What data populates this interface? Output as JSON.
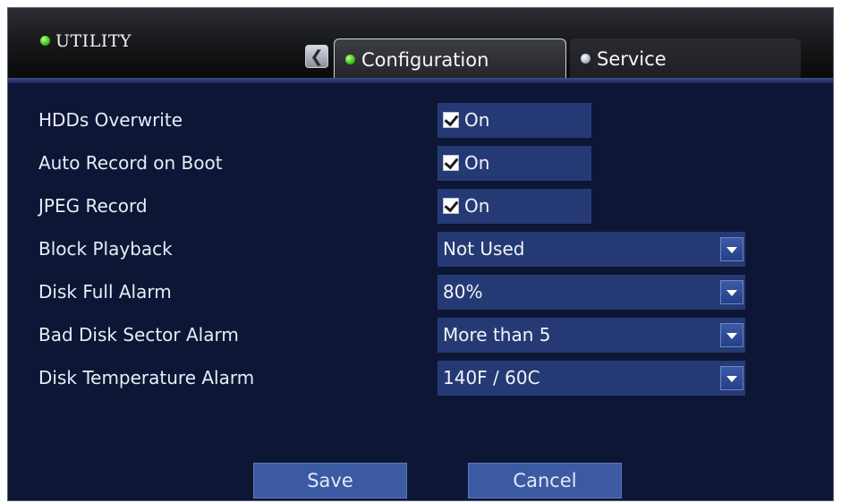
{
  "header": {
    "title": "UTILITY",
    "tabs": [
      {
        "label": "Configuration",
        "active": true,
        "status": "green"
      },
      {
        "label": "Service",
        "active": false,
        "status": "gray"
      }
    ],
    "back_icon": "chevron-left-icon"
  },
  "settings": {
    "hdds_overwrite": {
      "label": "HDDs Overwrite",
      "value": "On",
      "checked": true
    },
    "auto_record": {
      "label": "Auto Record on Boot",
      "value": "On",
      "checked": true
    },
    "jpeg_record": {
      "label": "JPEG Record",
      "value": "On",
      "checked": true
    },
    "block_playback": {
      "label": "Block Playback",
      "value": "Not Used"
    },
    "disk_full_alarm": {
      "label": "Disk Full Alarm",
      "value": "80%"
    },
    "bad_sector_alarm": {
      "label": "Bad Disk Sector Alarm",
      "value": "More than 5"
    },
    "disk_temp_alarm": {
      "label": "Disk Temperature Alarm",
      "value": "140F / 60C"
    }
  },
  "actions": {
    "save": "Save",
    "cancel": "Cancel"
  },
  "colors": {
    "panel_bg": "#0e1636",
    "field_bg": "#253a74",
    "button_bg": "#3b5aa2",
    "active_dot": "#39c21b"
  }
}
